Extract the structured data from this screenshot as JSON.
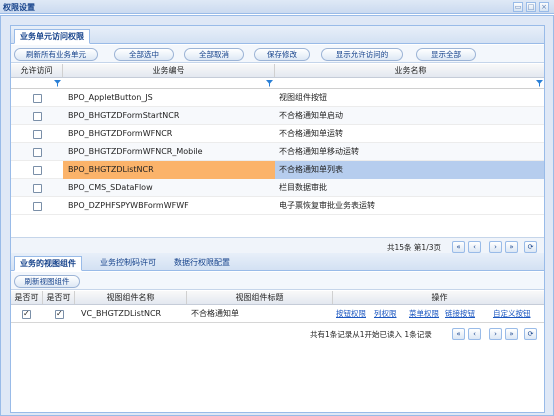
{
  "window": {
    "title": "权限设置",
    "tools": [
      "restore-icon",
      "maximize-icon",
      "close-icon"
    ]
  },
  "top_panel": {
    "tab": "业务单元访问权限",
    "toolbar": {
      "refresh": "刷新所有业务单元",
      "select_all": "全部选中",
      "cancel_all": "全部取消",
      "save": "保存修改",
      "show_allowed": "显示允许访问的",
      "show_all": "显示全部"
    },
    "columns": {
      "allow": "允许访问",
      "code": "业务编号",
      "name": "业务名称"
    },
    "rows": [
      {
        "code": "BPO_AppletButton_JS",
        "name": "视图组件按钮",
        "checked": false
      },
      {
        "code": "BPO_BHGTZDFormStartNCR",
        "name": "不合格通知单启动",
        "checked": false
      },
      {
        "code": "BPO_BHGTZDFormWFNCR",
        "name": "不合格通知单运转",
        "checked": false
      },
      {
        "code": "BPO_BHGTZDFormWFNCR_Mobile",
        "name": "不合格通知单移动运转",
        "checked": false
      },
      {
        "code": "BPO_BHGTZDListNCR",
        "name": "不合格通知单列表",
        "checked": false
      },
      {
        "code": "BPO_CMS_SDataFlow",
        "name": "栏目数据审批",
        "checked": false
      },
      {
        "code": "BPO_DZPHFSPYWBFormWFWF",
        "name": "电子票恢复审批业务表运转",
        "checked": false
      }
    ],
    "selected_index": 4,
    "pager": {
      "info": "共15条 第1/3页",
      "buttons": [
        "first-page-icon",
        "prev-page-icon",
        "next-page-icon",
        "last-page-icon",
        "refresh-icon"
      ]
    }
  },
  "bottom_panel": {
    "tabs": [
      "业务的视图组件",
      "业务控制码许可",
      "数据行权限配置"
    ],
    "active_tab": 0,
    "toolbar": {
      "refresh": "刷新视图组件"
    },
    "columns": {
      "visible": "是否可",
      "enabled": "是否可",
      "comp_name": "视图组件名称",
      "comp_title": "视图组件标题",
      "ops": "操作"
    },
    "rows": [
      {
        "visible": true,
        "enabled": true,
        "comp_name": "VC_BHGTZDListNCR",
        "comp_title": "不合格通知单",
        "ops": [
          "按钮权限",
          "列权限",
          "菜单权限",
          "链接按钮",
          "自定义按钮"
        ]
      }
    ],
    "pager": {
      "info": "共有1条记录从1开始已读入 1条记录",
      "buttons": [
        "first-page-icon",
        "prev-page-icon",
        "next-page-icon",
        "last-page-icon",
        "refresh-icon"
      ]
    }
  },
  "colors": {
    "header_bg": "#dfe8f6",
    "border": "#99bbe8",
    "selected_row_code": "#fbb36a",
    "selected_row_name": "#b6cdee",
    "link": "#1a56c0",
    "funnel": "#2a7fd6"
  }
}
